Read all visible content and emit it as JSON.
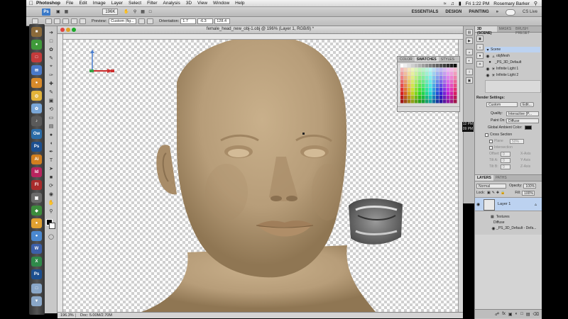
{
  "menubar": {
    "apple": "",
    "app": "Photoshop",
    "items": [
      "File",
      "Edit",
      "Image",
      "Layer",
      "Select",
      "Filter",
      "Analysis",
      "3D",
      "View",
      "Window",
      "Help"
    ],
    "clock": "Fri 1:22 PM",
    "user": "Rosemary Barker"
  },
  "appbar": {
    "logo": "Ps",
    "zoom": "196K",
    "workspaces": [
      "ESSENTIALS",
      "DESIGN",
      "PAINTING"
    ],
    "more": "»",
    "cs_live": "CS Live"
  },
  "options": {
    "preview_label": "Preview:",
    "preview_value": "Custom (fig...",
    "orientation_label": "Orientation:",
    "x": "1.7",
    "y": "-6.3",
    "z": "128.4"
  },
  "doc": {
    "title": "female_head_new_obj-1.obj @ 196% (Layer 1, RGB/8) *"
  },
  "status": {
    "zoom": "196.3%",
    "doc": "Doc: 5.00M/2.70M"
  },
  "swatches": {
    "tabs": [
      "COLOR",
      "SWATCHES",
      "STYLES"
    ],
    "active": "SWATCHES"
  },
  "time_overlay": {
    "line1": "12 PM",
    "line2": "09 PM"
  },
  "scene_panel": {
    "tabs": [
      "3D (SCENE)",
      "MASKS",
      "BRUSH PRESET"
    ],
    "active": "3D (SCENE)",
    "items": [
      "Scene",
      "objMesh",
      "_PS_3D_Default",
      "Infinite Light 1",
      "Infinite Light 2"
    ]
  },
  "render": {
    "header": "Render Settings:",
    "preset": "Custom",
    "edit": "Edit...",
    "quality_label": "Quality:",
    "quality_value": "Interactive (P...",
    "paint_on_label": "Paint On:",
    "paint_on_value": "Diffuse",
    "global_ambient": "Global Ambient Color:",
    "cross_section": "Cross Section",
    "plane_label": "Plane",
    "plane_value": "50%",
    "intersection": "Intersection",
    "offset_label": "Offset:",
    "tilt_a_label": "Tilt A:",
    "tilt_b_label": "Tilt B:",
    "zero": "0",
    "x_axis": "X-Axis",
    "y_axis": "Y-Axis",
    "z_axis": "Z-Axis"
  },
  "layers": {
    "tabs": [
      "LAYERS",
      "PATHS"
    ],
    "active": "LAYERS",
    "blend": "Normal",
    "opacity_label": "Opacity:",
    "opacity_value": "100%",
    "lock_label": "Lock:",
    "fill_label": "Fill:",
    "fill_value": "100%",
    "layer_name": "Layer 1",
    "textures_label": "Textures",
    "diffuse_label": "Diffuse",
    "texture_name": "_PS_3D_Default - Defa..."
  },
  "colors": {
    "face": "#b79d79",
    "panel": "#c9c9c9",
    "accent": "#3a79c8"
  }
}
